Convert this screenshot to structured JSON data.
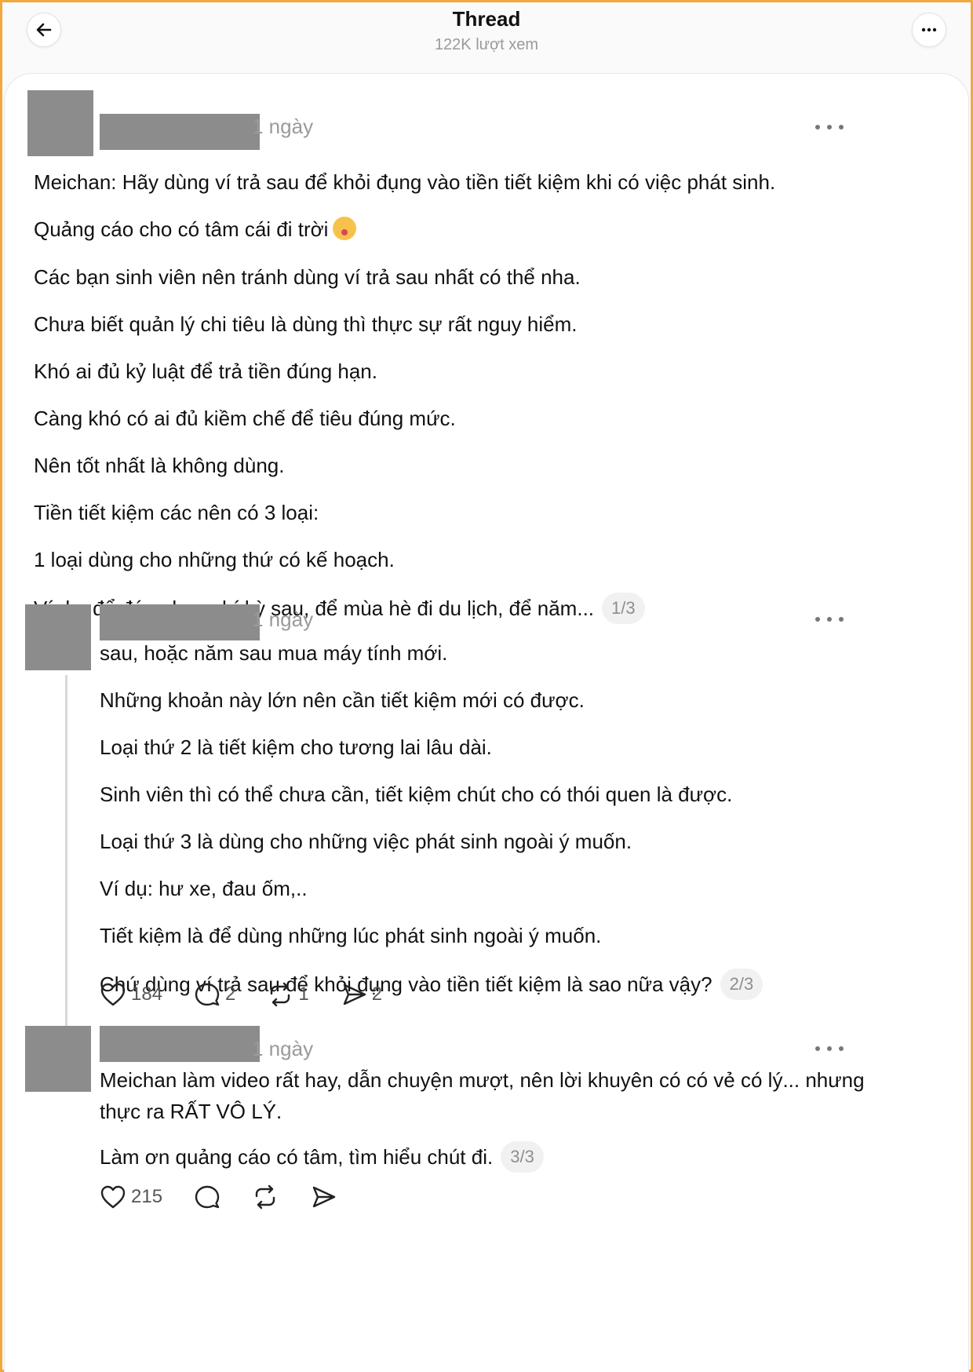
{
  "header": {
    "title": "Thread",
    "views": "122K lượt xem"
  },
  "posts": [
    {
      "time": "1 ngày",
      "lines": [
        "Meichan: Hãy dùng ví trả sau để khỏi đụng vào tiền tiết kiệm khi có việc phát sinh.",
        "Quảng cáo cho có tâm cái đi trời",
        "Các bạn sinh viên nên tránh dùng ví trả sau nhất có thể nha.",
        "Chưa biết quản lý chi tiêu là dùng thì thực sự rất nguy hiểm.",
        "Khó ai đủ kỷ luật để trả tiền đúng hạn.",
        "Càng khó có ai đủ kiềm chế để tiêu đúng mức.",
        "Nên tốt nhất là không dùng.",
        "Tiền tiết kiệm các nên có 3 loại:",
        "1 loại dùng cho những thứ có kế hoạch.",
        "Ví dụ: để đóng học phí kỳ sau, để mùa hè đi du lịch, để năm..."
      ],
      "emoji": "tear-smile-emoji",
      "pager": "1/3"
    },
    {
      "time": "1 ngày",
      "lines": [
        "sau, hoặc năm sau mua máy tính mới.",
        "Những khoản này lớn nên cần tiết kiệm mới có được.",
        "Loại thứ 2 là tiết kiệm cho tương lai lâu dài.",
        "Sinh viên thì có thể chưa cần, tiết kiệm chút cho có thói quen là được.",
        "Loại thứ 3 là dùng cho những việc phát sinh ngoài ý muốn.",
        "Ví dụ: hư xe, đau ốm,..",
        "Tiết kiệm là để dùng những lúc phát sinh ngoài ý muốn.",
        "Chứ dùng ví trả sau để khỏi đụng vào tiền tiết kiệm là sao nữa vậy?"
      ],
      "pager": "2/3",
      "likes": "184",
      "replies": "2",
      "reposts": "1",
      "shares": "2"
    },
    {
      "time": "1 ngày",
      "lines": [
        "Meichan làm video rất hay, dẫn chuyện mượt, nên lời khuyên có có vẻ có lý... nhưng thực ra RẤT VÔ LÝ.",
        "Làm ơn quảng cáo có tâm, tìm hiểu chút đi."
      ],
      "pager": "3/3",
      "likes": "215"
    }
  ],
  "colors": {
    "frame": "#f0a93a",
    "placeholder": "#8c8c8c",
    "muted": "#9a9a9a"
  }
}
